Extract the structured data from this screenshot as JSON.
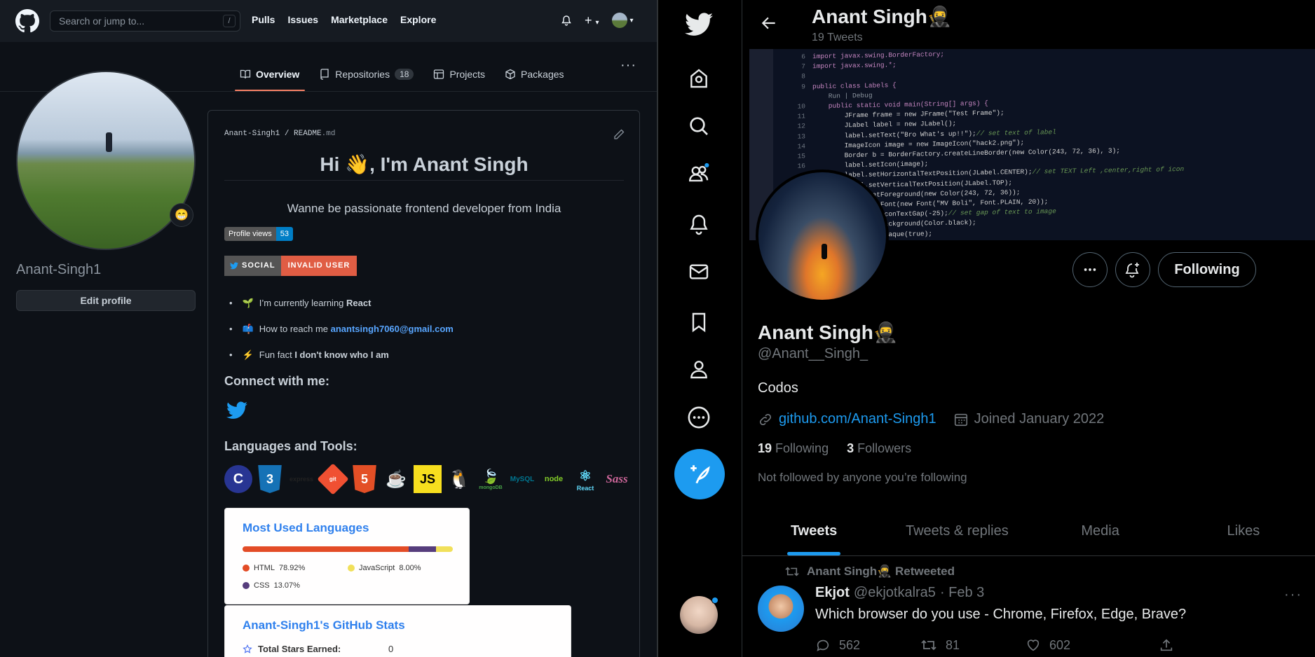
{
  "github": {
    "header": {
      "search_placeholder": "Search or jump to...",
      "slash_key": "/",
      "nav": [
        "Pulls",
        "Issues",
        "Marketplace",
        "Explore"
      ]
    },
    "tabs": [
      {
        "label": "Overview"
      },
      {
        "label": "Repositories",
        "count": "18"
      },
      {
        "label": "Projects"
      },
      {
        "label": "Packages"
      }
    ],
    "profile": {
      "username": "Anant-Singh1",
      "edit_label": "Edit profile",
      "status_emoji": "😁"
    },
    "readme": {
      "path_user": "Anant-Singh1",
      "path_sep": " / ",
      "path_file": "README",
      "path_ext": ".md",
      "heading": "Hi 👋, I'm Anant Singh",
      "subheading": "Wanne be passionate frontend developer from India",
      "views_label": "Profile views",
      "views_count": "53",
      "social_label": "SOCIAL",
      "social_status": "INVALID USER",
      "bullets": [
        {
          "emoji": "🌱",
          "text": "I’m currently learning ",
          "bold": "React"
        },
        {
          "emoji": "📫",
          "text": "How to reach me ",
          "link": "anantsingh7060@gmail.com"
        },
        {
          "emoji": "⚡",
          "text": "Fun fact ",
          "bold": "I don't know who I am"
        }
      ],
      "connect_heading": "Connect with me:",
      "tools_heading": "Languages and Tools:",
      "tools": [
        "c",
        "css3",
        "express",
        "git",
        "html5",
        "java",
        "javascript",
        "linux",
        "mongodb",
        "mysql",
        "nodejs",
        "react",
        "sass"
      ],
      "tool_labels": {
        "c": "C",
        "css3": "3",
        "git": "git",
        "html5": "5",
        "java": "☕",
        "js": "JS",
        "mongodb": "mongoDB",
        "mysql": "MySQL",
        "nodejs": "node",
        "react": "React",
        "sass": "Sass"
      }
    },
    "langs_card": {
      "title": "Most Used Languages",
      "languages": [
        {
          "name": "HTML",
          "percent": "78.92%",
          "value": 78.92,
          "color": "#e34c26"
        },
        {
          "name": "JavaScript",
          "percent": "8.00%",
          "value": 8.0,
          "color": "#f1e05a"
        },
        {
          "name": "CSS",
          "percent": "13.07%",
          "value": 13.07,
          "color": "#563d7c"
        }
      ]
    },
    "stats_card": {
      "title": "Anant-Singh1's GitHub Stats",
      "stars_label": "Total Stars Earned:",
      "stars_value": "0"
    }
  },
  "twitter": {
    "header": {
      "name": "Anant Singh🥷",
      "tweet_count": "19 Tweets"
    },
    "profile": {
      "name": "Anant Singh🥷",
      "handle": "@Anant__Singh_",
      "bio": "Codos",
      "link": "github.com/Anant-Singh1",
      "joined": "Joined January 2022",
      "following_count": "19",
      "following_label": "Following",
      "followers_count": "3",
      "followers_label": "Followers",
      "not_followed": "Not followed by anyone you’re following",
      "following_button": "Following"
    },
    "tabs": [
      "Tweets",
      "Tweets & replies",
      "Media",
      "Likes"
    ],
    "tweet": {
      "retweeted_by": "Anant Singh🥷 Retweeted",
      "author": "Ekjot",
      "handle": "@ekjotkalra5",
      "date": "· Feb 3",
      "text": "Which browser do you use - Chrome, Firefox, Edge, Brave?",
      "replies": "562",
      "retweets": "81",
      "likes": "602"
    },
    "banner_code": [
      {
        "n": "6",
        "t": "import javax.swing.BorderFactory;"
      },
      {
        "n": "7",
        "t": "import javax.swing.*;"
      },
      {
        "n": "8",
        "t": ""
      },
      {
        "n": "9",
        "t": "public class Labels {"
      },
      {
        "n": "",
        "t": "    Run | Debug"
      },
      {
        "n": "10",
        "t": "    public static void main(String[] args) {"
      },
      {
        "n": "11",
        "t": "        JFrame frame = new JFrame(\"Test Frame\");"
      },
      {
        "n": "12",
        "t": "        JLabel label = new JLabel();"
      },
      {
        "n": "13",
        "t": "        label.setText(\"Bro What's up!!\");// set text of label"
      },
      {
        "n": "14",
        "t": "        ImageIcon image = new ImageIcon(\"hack2.png\");"
      },
      {
        "n": "15",
        "t": "        Border b = BorderFactory.createLineBorder(new Color(243, 72, 36), 3);"
      },
      {
        "n": "16",
        "t": "        label.setIcon(image);"
      },
      {
        "n": "",
        "t": "        label.setHorizontalTextPosition(JLabel.CENTER);// set TEXT Left ,center,right of icon"
      },
      {
        "n": "",
        "t": "        label.setVerticalTextPosition(JLabel.TOP);"
      },
      {
        "n": "",
        "t": "        label.setForeground(new Color(243, 72, 36));"
      },
      {
        "n": "",
        "t": "        label.setFont(new Font(\"MV Boli\", Font.PLAIN, 20));"
      },
      {
        "n": "",
        "t": "        label.setIconTextGap(-25);// set gap of text to image"
      },
      {
        "n": "",
        "t": "        label.setBackground(Color.black);"
      },
      {
        "n": "",
        "t": "        label.setOpaque(true);"
      }
    ]
  }
}
